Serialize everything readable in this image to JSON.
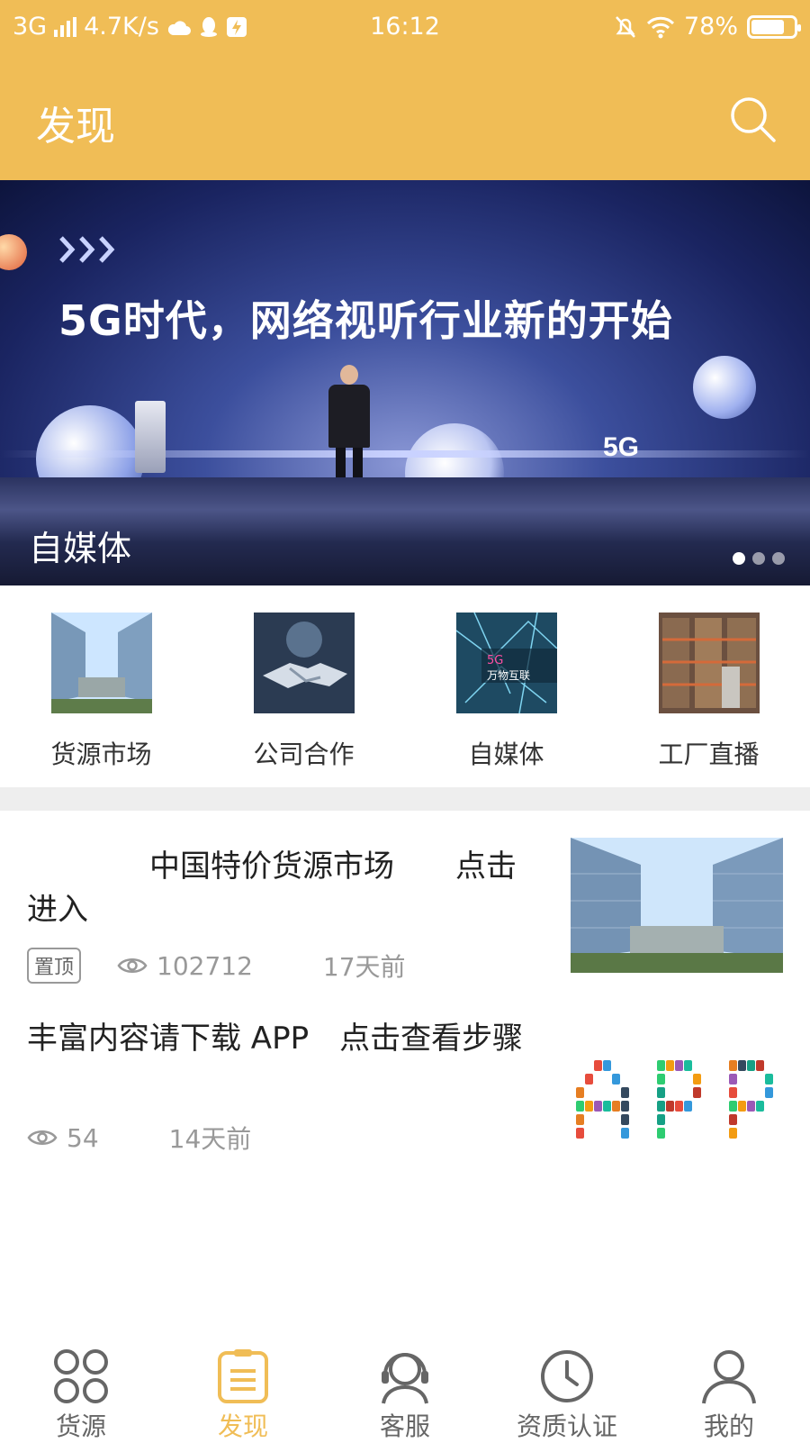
{
  "status_bar": {
    "network": "3G",
    "speed": "4.7K/s",
    "time": "16:12",
    "battery": "78%",
    "battery_level": 0.78
  },
  "header": {
    "title": "发现",
    "search_icon": "search-icon"
  },
  "banner": {
    "headline": "5G时代，网络视听行业新的开始",
    "caption": "自媒体",
    "slides": 3,
    "active_slide": 1
  },
  "categories": [
    {
      "label": "货源市场",
      "icon": "building-photo"
    },
    {
      "label": "公司合作",
      "icon": "handshake-photo"
    },
    {
      "label": "自媒体",
      "icon": "network-photo"
    },
    {
      "label": "工厂直播",
      "icon": "warehouse-photo"
    }
  ],
  "articles": [
    {
      "title": "　　　　中国特价货源市场　　点击进入",
      "badge": "置顶",
      "views": "102712",
      "time": "17天前"
    },
    {
      "title": "丰富内容请下载 APP　点击查看步骤",
      "badge": "",
      "views": "54",
      "time": "14天前"
    }
  ],
  "tabs": [
    {
      "label": "货源",
      "icon": "grid-icon",
      "active": false
    },
    {
      "label": "发现",
      "icon": "clipboard-icon",
      "active": true
    },
    {
      "label": "客服",
      "icon": "headset-icon",
      "active": false
    },
    {
      "label": "资质认证",
      "icon": "clock-icon",
      "active": false
    },
    {
      "label": "我的",
      "icon": "user-icon",
      "active": false
    }
  ],
  "colors": {
    "accent": "#f0bd56",
    "inactive": "#666666"
  }
}
